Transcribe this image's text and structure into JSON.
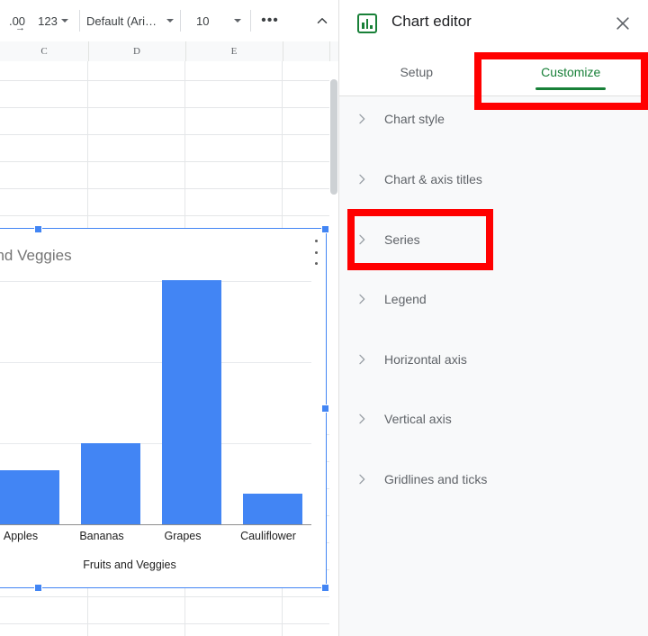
{
  "toolbar": {
    "decimal_decrease_label": ".00",
    "decimal_decrease_arrow": "→",
    "number_format_label": "123",
    "font_label": "Default (Ari…",
    "font_size_label": "10",
    "more_label": "•••",
    "collapse_icon": "chevron-up-icon"
  },
  "sheet": {
    "column_headers": [
      "C",
      "D",
      "E",
      ""
    ]
  },
  "chart": {
    "title_visible": "and Veggies",
    "menu_icon": "more-vert-icon"
  },
  "chart_data": {
    "type": "bar",
    "title": "Fruits and Veggies",
    "categories": [
      "Apples",
      "Bananas",
      "Grapes",
      "Cauliflower"
    ],
    "values": [
      22,
      33,
      94,
      11
    ],
    "xlabel": "Fruits and Veggies",
    "ylabel": "",
    "ylim": [
      0,
      100
    ],
    "gridlines": [
      25,
      50,
      75
    ],
    "grid": true,
    "legend": "none",
    "series_color": "#4285F4"
  },
  "editor": {
    "title": "Chart editor",
    "icon": "bar-chart-icon",
    "close_label": "×",
    "tabs": [
      {
        "label": "Setup",
        "active": false
      },
      {
        "label": "Customize",
        "active": true
      }
    ],
    "sections": [
      {
        "label": "Chart style"
      },
      {
        "label": "Chart & axis titles"
      },
      {
        "label": "Series"
      },
      {
        "label": "Legend"
      },
      {
        "label": "Horizontal axis"
      },
      {
        "label": "Vertical axis"
      },
      {
        "label": "Gridlines and ticks"
      }
    ]
  },
  "annotations": {
    "color": "#FF0000",
    "highlight_customize": "Customize",
    "highlight_series": "Series"
  }
}
